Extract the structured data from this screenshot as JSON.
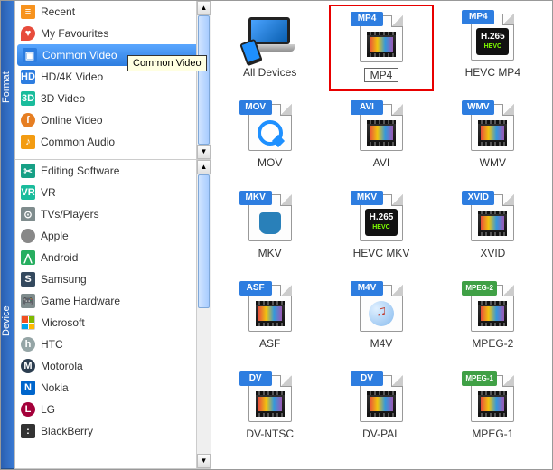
{
  "vtabs": {
    "format": "Format",
    "device": "Device"
  },
  "tooltip": "Common Video",
  "format_items": [
    {
      "id": "recent",
      "label": "Recent"
    },
    {
      "id": "favourites",
      "label": "My Favourites"
    },
    {
      "id": "common-video",
      "label": "Common Video"
    },
    {
      "id": "hd-4k-video",
      "label": "HD/4K Video"
    },
    {
      "id": "3d-video",
      "label": "3D Video"
    },
    {
      "id": "online-video",
      "label": "Online Video"
    },
    {
      "id": "common-audio",
      "label": "Common Audio"
    }
  ],
  "device_items": [
    {
      "id": "editing-software",
      "label": "Editing Software"
    },
    {
      "id": "vr",
      "label": "VR"
    },
    {
      "id": "tvs-players",
      "label": "TVs/Players"
    },
    {
      "id": "apple",
      "label": "Apple"
    },
    {
      "id": "android",
      "label": "Android"
    },
    {
      "id": "samsung",
      "label": "Samsung"
    },
    {
      "id": "game-hardware",
      "label": "Game Hardware"
    },
    {
      "id": "microsoft",
      "label": "Microsoft"
    },
    {
      "id": "htc",
      "label": "HTC"
    },
    {
      "id": "motorola",
      "label": "Motorola"
    },
    {
      "id": "nokia",
      "label": "Nokia"
    },
    {
      "id": "lg",
      "label": "LG"
    },
    {
      "id": "blackberry",
      "label": "BlackBerry"
    }
  ],
  "grid": [
    {
      "id": "all-devices",
      "caption": "All Devices",
      "badge": "",
      "kind": "alldev"
    },
    {
      "id": "mp4",
      "caption": "MP4",
      "badge": "MP4",
      "kind": "film",
      "highlight": true
    },
    {
      "id": "hevc-mp4",
      "caption": "HEVC MP4",
      "badge": "MP4",
      "kind": "hevc"
    },
    {
      "id": "mov",
      "caption": "MOV",
      "badge": "MOV",
      "kind": "qt"
    },
    {
      "id": "avi",
      "caption": "AVI",
      "badge": "AVI",
      "kind": "film"
    },
    {
      "id": "wmv",
      "caption": "WMV",
      "badge": "WMV",
      "kind": "film"
    },
    {
      "id": "mkv",
      "caption": "MKV",
      "badge": "MKV",
      "kind": "matroska"
    },
    {
      "id": "hevc-mkv",
      "caption": "HEVC MKV",
      "badge": "MKV",
      "kind": "hevc"
    },
    {
      "id": "xvid",
      "caption": "XVID",
      "badge": "XVID",
      "kind": "film"
    },
    {
      "id": "asf",
      "caption": "ASF",
      "badge": "ASF",
      "kind": "film"
    },
    {
      "id": "m4v",
      "caption": "M4V",
      "badge": "M4V",
      "kind": "itunes"
    },
    {
      "id": "mpeg2",
      "caption": "MPEG-2",
      "badge": "MPEG-2",
      "kind": "film",
      "badgeClass": "mpeg"
    },
    {
      "id": "dv-ntsc",
      "caption": "DV-NTSC",
      "badge": "DV",
      "kind": "film"
    },
    {
      "id": "dv-pal",
      "caption": "DV-PAL",
      "badge": "DV",
      "kind": "film"
    },
    {
      "id": "mpeg1",
      "caption": "MPEG-1",
      "badge": "MPEG-1",
      "kind": "film",
      "badgeClass": "mpeg"
    }
  ],
  "hevc": {
    "line1": "H.265",
    "line2": "HEVC"
  },
  "scroll": {
    "up": "▲",
    "down": "▼"
  },
  "colors": {
    "accent": "#2d7de0",
    "highlight_border": "#e80000"
  }
}
